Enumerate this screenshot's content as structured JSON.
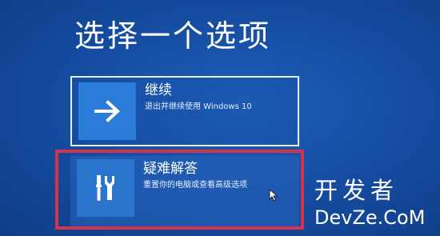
{
  "page": {
    "title": "选择一个选项"
  },
  "options": [
    {
      "title": "继续",
      "description": "退出并继续使用 Windows 10",
      "icon": "arrow-right-icon"
    },
    {
      "title": "疑难解答",
      "description": "重置你的电脑或查看高级选项",
      "icon": "tools-icon"
    }
  ],
  "watermark": {
    "line1": "开发者",
    "line2": "DevZe.CoM"
  },
  "colors": {
    "background": "#164ea3",
    "tile": "#2a78d6",
    "highlight": "#d4334a",
    "text": "#ffffff"
  }
}
